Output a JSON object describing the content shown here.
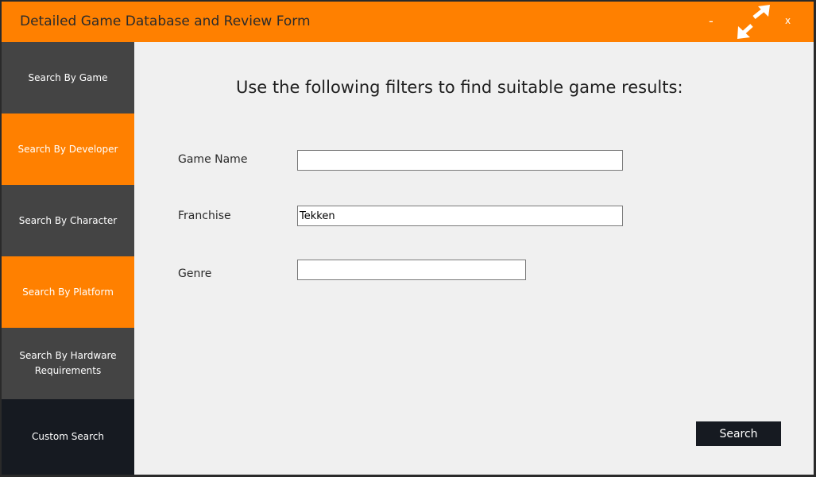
{
  "window": {
    "title": "Detailed Game Database and Review Form",
    "minimize_label": "-",
    "close_label": "x",
    "accent_color": "#ff8000"
  },
  "sidebar": {
    "items": [
      {
        "label": "Search By Game",
        "bg": "#444444"
      },
      {
        "label": "Search By Developer",
        "bg": "#ff8000"
      },
      {
        "label": "Search By Character",
        "bg": "#444444"
      },
      {
        "label": "Search By Platform",
        "bg": "#ff8000"
      },
      {
        "label": "Search By Hardware\nRequirements",
        "bg": "#444444"
      },
      {
        "label": "Custom Search",
        "bg": "#161a21"
      }
    ]
  },
  "main": {
    "heading": "Use the following filters to find suitable game results:",
    "fields": {
      "game_name": {
        "label": "Game Name",
        "value": ""
      },
      "franchise": {
        "label": "Franchise",
        "value": "Tekken"
      },
      "genre": {
        "label": "Genre",
        "value": ""
      }
    },
    "search_label": "Search"
  },
  "icons": {
    "maximize": "expand-arrows-icon"
  }
}
